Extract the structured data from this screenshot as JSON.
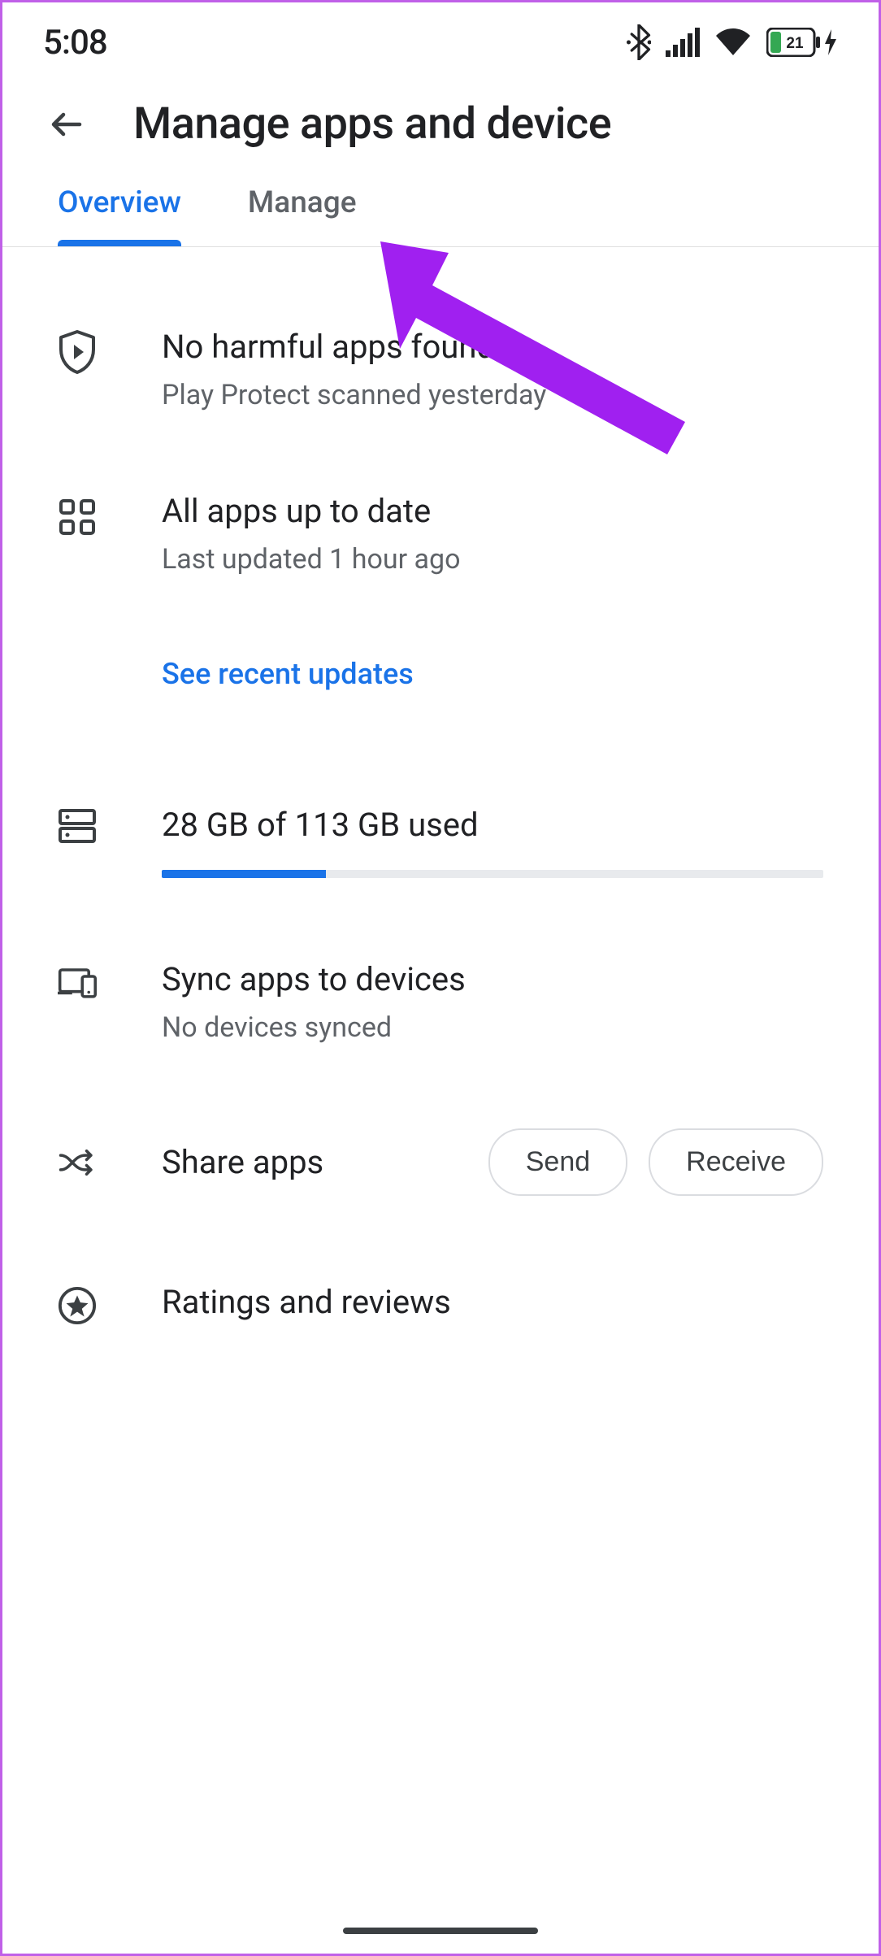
{
  "status": {
    "time": "5:08",
    "battery_percent": "21"
  },
  "header": {
    "title": "Manage apps and device"
  },
  "tabs": {
    "overview": "Overview",
    "manage": "Manage"
  },
  "protect": {
    "title": "No harmful apps found",
    "sub": "Play Protect scanned yesterday"
  },
  "updates": {
    "title": "All apps up to date",
    "sub": "Last updated 1 hour ago",
    "link": "See recent updates"
  },
  "storage": {
    "title": "28 GB of 113 GB used",
    "used": 28,
    "total": 113
  },
  "sync": {
    "title": "Sync apps to devices",
    "sub": "No devices synced"
  },
  "share": {
    "title": "Share apps",
    "send": "Send",
    "receive": "Receive"
  },
  "ratings": {
    "title": "Ratings and reviews"
  }
}
